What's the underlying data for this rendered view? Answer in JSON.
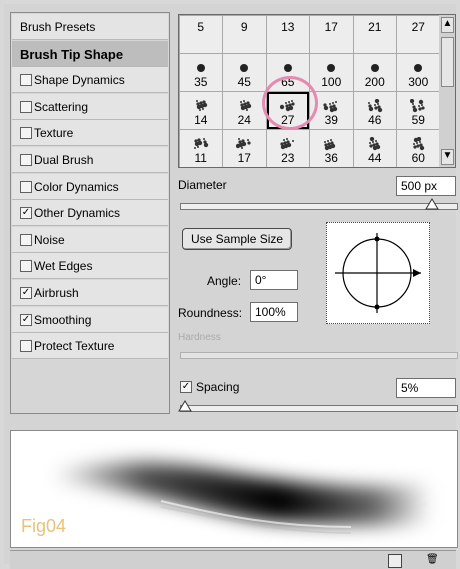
{
  "sidebar": {
    "items": [
      {
        "label": "Brush Presets",
        "checkbox": false,
        "checked": false,
        "selected": false
      },
      {
        "label": "Brush Tip Shape",
        "checkbox": false,
        "checked": false,
        "selected": true
      },
      {
        "label": "Shape Dynamics",
        "checkbox": true,
        "checked": false,
        "selected": false
      },
      {
        "label": "Scattering",
        "checkbox": true,
        "checked": false,
        "selected": false
      },
      {
        "label": "Texture",
        "checkbox": true,
        "checked": false,
        "selected": false
      },
      {
        "label": "Dual Brush",
        "checkbox": true,
        "checked": false,
        "selected": false
      },
      {
        "label": "Color Dynamics",
        "checkbox": true,
        "checked": false,
        "selected": false
      },
      {
        "label": "Other Dynamics",
        "checkbox": true,
        "checked": true,
        "selected": false
      },
      {
        "label": "Noise",
        "checkbox": true,
        "checked": false,
        "selected": false
      },
      {
        "label": "Wet Edges",
        "checkbox": true,
        "checked": false,
        "selected": false
      },
      {
        "label": "Airbrush",
        "checkbox": true,
        "checked": true,
        "selected": false
      },
      {
        "label": "Smoothing",
        "checkbox": true,
        "checked": true,
        "selected": false
      },
      {
        "label": "Protect Texture",
        "checkbox": true,
        "checked": false,
        "selected": false
      }
    ],
    "check_mark": "✓"
  },
  "brushes": {
    "rows": [
      [
        "5",
        "9",
        "13",
        "17",
        "21",
        "27"
      ],
      [
        "35",
        "45",
        "65",
        "100",
        "200",
        "300"
      ],
      [
        "14",
        "24",
        "27",
        "39",
        "46",
        "59"
      ],
      [
        "11",
        "17",
        "23",
        "36",
        "44",
        "60"
      ]
    ],
    "selected_row": 2,
    "selected_col": 2
  },
  "diameter": {
    "label": "Diameter",
    "value": "500 px"
  },
  "use_sample_size": "Use Sample Size",
  "angle": {
    "label": "Angle:",
    "value": "0°"
  },
  "roundness": {
    "label": "Roundness:",
    "value": "100%"
  },
  "hardness": {
    "label": "Hardness"
  },
  "spacing": {
    "label": "Spacing",
    "value": "5%",
    "checked": true
  },
  "preview": {
    "caption": "Fig04"
  },
  "colors": {
    "ring": "#e58ab0",
    "fig_text": "#e8c27a"
  }
}
